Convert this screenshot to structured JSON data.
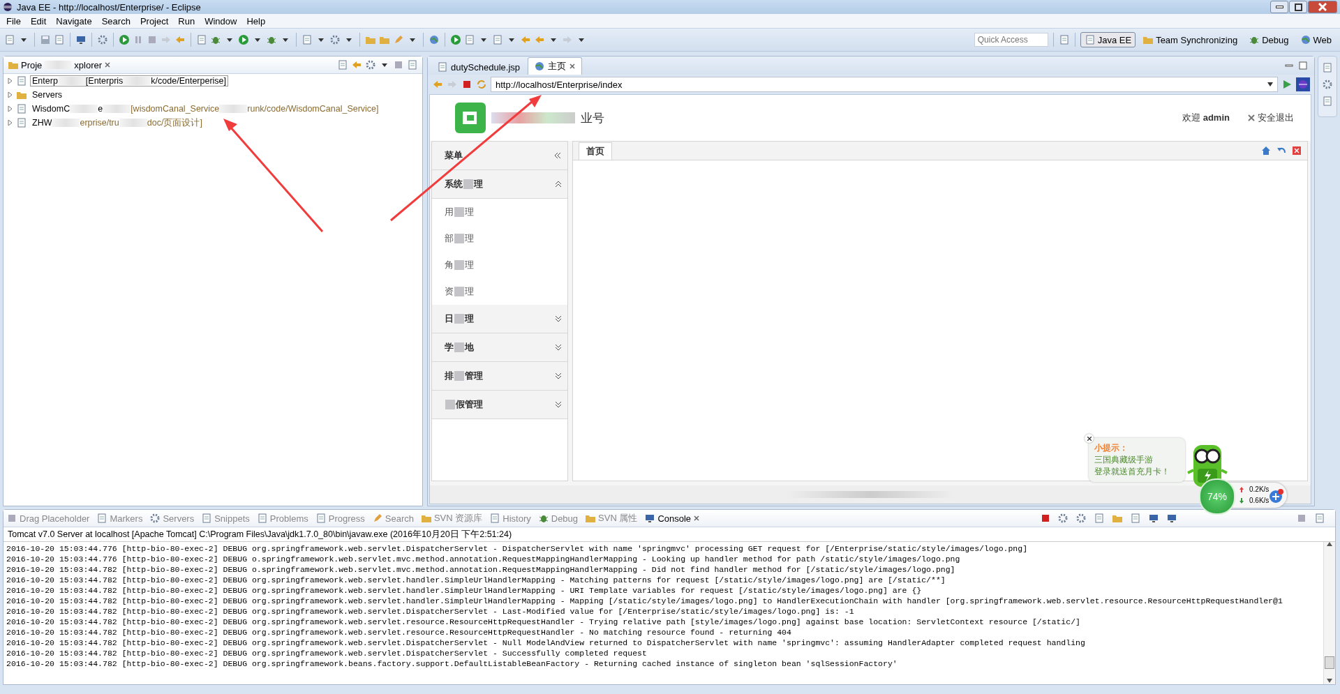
{
  "window": {
    "title": "Java EE - http://localhost/Enterprise/ - Eclipse"
  },
  "menu": [
    "File",
    "Edit",
    "Navigate",
    "Search",
    "Project",
    "Run",
    "Window",
    "Help"
  ],
  "quick_access": {
    "placeholder": "Quick Access"
  },
  "perspectives": [
    {
      "label": "Java EE",
      "selected": true
    },
    {
      "label": "Team Synchronizing",
      "selected": false
    },
    {
      "label": "Debug",
      "selected": false
    },
    {
      "label": "Web",
      "selected": false
    }
  ],
  "explorer": {
    "title_parts": [
      "Proje",
      "xplorer"
    ],
    "items": [
      {
        "selected": true,
        "parts": [
          {
            "text": "Enterp",
            "kind": "name"
          },
          {
            "text": "[Enterpris",
            "kind": "plain"
          },
          {
            "text": "k/code/Enterperise]",
            "kind": "plain"
          }
        ]
      },
      {
        "selected": false,
        "parts": [
          {
            "text": "Servers",
            "kind": "name"
          }
        ]
      },
      {
        "selected": false,
        "parts": [
          {
            "text": "WisdomC",
            "kind": "name"
          },
          {
            "text": "e",
            "kind": "name"
          },
          {
            "text": "[wisdomCanal_Service",
            "kind": "path"
          },
          {
            "text": "runk/code/WisdomCanal_Service]",
            "kind": "path"
          }
        ]
      },
      {
        "selected": false,
        "parts": [
          {
            "text": "ZHW",
            "kind": "name"
          },
          {
            "text": "erprise/tru",
            "kind": "path"
          },
          {
            "text": "doc/页面设计]",
            "kind": "path"
          }
        ]
      }
    ]
  },
  "editor_tabs": [
    {
      "label": "dutySchedule.jsp",
      "selected": false
    },
    {
      "label": "主页",
      "selected": true
    }
  ],
  "browser": {
    "url": "http://localhost/Enterprise/index"
  },
  "page": {
    "logo_text": "业号",
    "welcome": "欢迎",
    "user": "admin",
    "logout": "安全退出",
    "menu_title": "菜单",
    "groups": [
      {
        "parts": [
          "系统",
          "理"
        ],
        "expanded": true,
        "items": [
          {
            "parts": [
              "用",
              "理"
            ]
          },
          {
            "parts": [
              "部",
              "理"
            ]
          },
          {
            "parts": [
              "角",
              "理"
            ]
          },
          {
            "parts": [
              "资",
              "理"
            ]
          }
        ]
      },
      {
        "parts": [
          "日",
          "理"
        ],
        "expanded": false
      },
      {
        "parts": [
          "学",
          "地"
        ],
        "expanded": false
      },
      {
        "parts": [
          "排",
          "管理"
        ],
        "expanded": false
      },
      {
        "parts": [
          "假管理"
        ],
        "expanded": false
      }
    ],
    "tabs": [
      {
        "label": "首页",
        "selected": true
      }
    ]
  },
  "bottom_tabs": [
    {
      "label": "Drag Placeholder",
      "selected": false
    },
    {
      "label": "Markers",
      "selected": false
    },
    {
      "label": "Servers",
      "selected": false
    },
    {
      "label": "Snippets",
      "selected": false
    },
    {
      "label": "Problems",
      "selected": false
    },
    {
      "label": "Progress",
      "selected": false
    },
    {
      "label": "Search",
      "selected": false
    },
    {
      "label": "SVN 资源库",
      "selected": false
    },
    {
      "label": "History",
      "selected": false
    },
    {
      "label": "Debug",
      "selected": false
    },
    {
      "label": "SVN 属性",
      "selected": false
    },
    {
      "label": "Console",
      "selected": true
    }
  ],
  "console": {
    "header": "Tomcat v7.0 Server at localhost [Apache Tomcat] C:\\Program Files\\Java\\jdk1.7.0_80\\bin\\javaw.exe (2016年10月20日 下午2:51:24)",
    "lines": [
      "2016-10-20 15:03:44.776 [http-bio-80-exec-2] DEBUG org.springframework.web.servlet.DispatcherServlet - DispatcherServlet with name 'springmvc' processing GET request for [/Enterprise/static/style/images/logo.png]",
      "2016-10-20 15:03:44.776 [http-bio-80-exec-2] DEBUG o.springframework.web.servlet.mvc.method.annotation.RequestMappingHandlerMapping - Looking up handler method for path /static/style/images/logo.png",
      "2016-10-20 15:03:44.782 [http-bio-80-exec-2] DEBUG o.springframework.web.servlet.mvc.method.annotation.RequestMappingHandlerMapping - Did not find handler method for [/static/style/images/logo.png]",
      "2016-10-20 15:03:44.782 [http-bio-80-exec-2] DEBUG org.springframework.web.servlet.handler.SimpleUrlHandlerMapping - Matching patterns for request [/static/style/images/logo.png] are [/static/**]",
      "2016-10-20 15:03:44.782 [http-bio-80-exec-2] DEBUG org.springframework.web.servlet.handler.SimpleUrlHandlerMapping - URI Template variables for request [/static/style/images/logo.png] are {}",
      "2016-10-20 15:03:44.782 [http-bio-80-exec-2] DEBUG org.springframework.web.servlet.handler.SimpleUrlHandlerMapping - Mapping [/static/style/images/logo.png] to HandlerExecutionChain with handler [org.springframework.web.servlet.resource.ResourceHttpRequestHandler@1",
      "2016-10-20 15:03:44.782 [http-bio-80-exec-2] DEBUG org.springframework.web.servlet.DispatcherServlet - Last-Modified value for [/Enterprise/static/style/images/logo.png] is: -1",
      "2016-10-20 15:03:44.782 [http-bio-80-exec-2] DEBUG org.springframework.web.servlet.resource.ResourceHttpRequestHandler - Trying relative path [style/images/logo.png] against base location: ServletContext resource [/static/]",
      "2016-10-20 15:03:44.782 [http-bio-80-exec-2] DEBUG org.springframework.web.servlet.resource.ResourceHttpRequestHandler - No matching resource found - returning 404",
      "2016-10-20 15:03:44.782 [http-bio-80-exec-2] DEBUG org.springframework.web.servlet.DispatcherServlet - Null ModelAndView returned to DispatcherServlet with name 'springmvc': assuming HandlerAdapter completed request handling",
      "2016-10-20 15:03:44.782 [http-bio-80-exec-2] DEBUG org.springframework.web.servlet.DispatcherServlet - Successfully completed request",
      "2016-10-20 15:03:44.782 [http-bio-80-exec-2] DEBUG org.springframework.beans.factory.support.DefaultListableBeanFactory - Returning cached instance of singleton bean 'sqlSessionFactory'"
    ]
  },
  "tip": {
    "title": "小提示：",
    "lines": [
      "三国典藏级手游",
      "登录就送首充月卡！"
    ]
  },
  "speed": {
    "percent": "74%",
    "up": "0.2K/s",
    "down": "0.6K/s"
  }
}
